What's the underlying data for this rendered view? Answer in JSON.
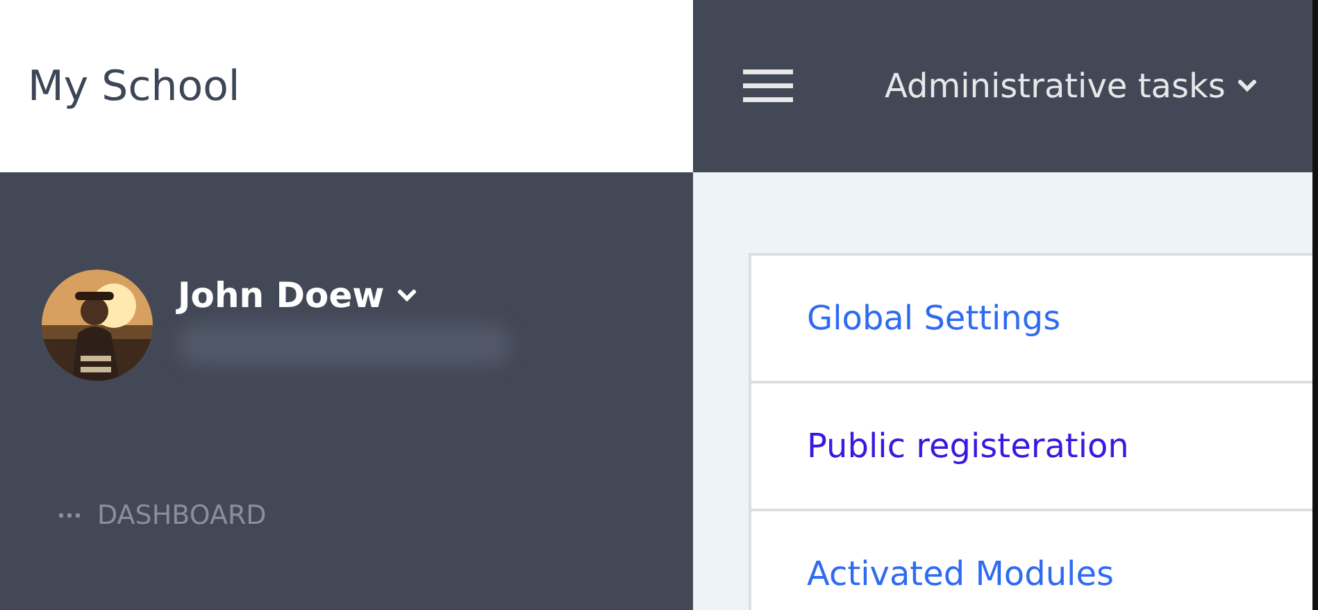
{
  "brand": {
    "title": "My School"
  },
  "topbar": {
    "menu_label": "Administrative tasks"
  },
  "user": {
    "name": "John Doew"
  },
  "sidebar": {
    "items": [
      {
        "label": "DASHBOARD",
        "selected": false
      }
    ]
  },
  "links": [
    {
      "label": "Global Settings",
      "visited": false
    },
    {
      "label": "Public registeration",
      "visited": true
    },
    {
      "label": "Activated Modules",
      "visited": false
    }
  ]
}
